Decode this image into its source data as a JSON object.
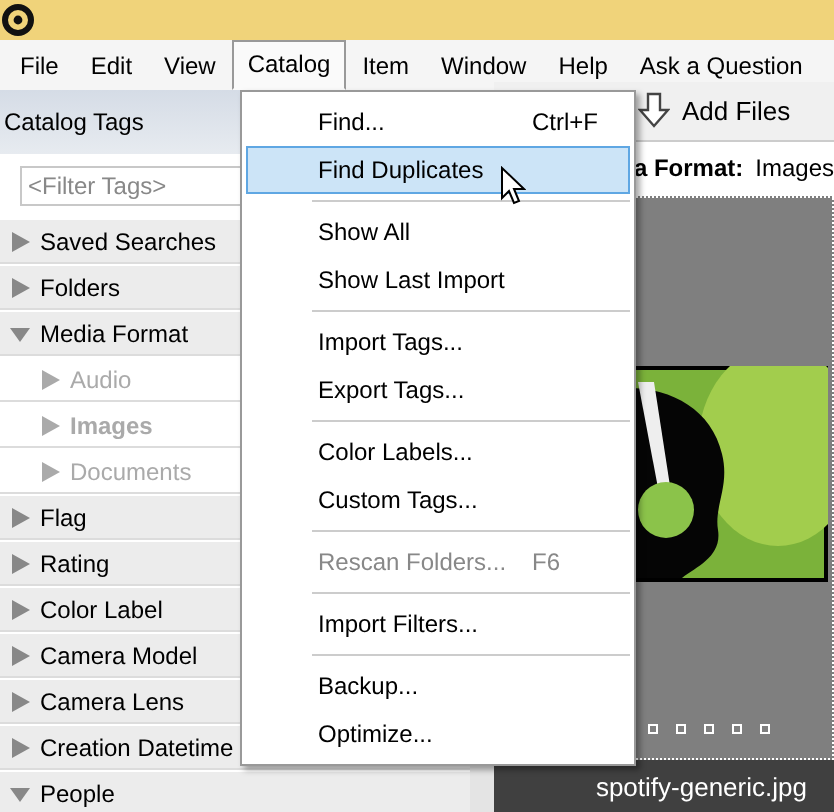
{
  "menu_bar": [
    {
      "label": "File",
      "selected": false
    },
    {
      "label": "Edit",
      "selected": false
    },
    {
      "label": "View",
      "selected": false
    },
    {
      "label": "Catalog",
      "selected": true
    },
    {
      "label": "Item",
      "selected": false
    },
    {
      "label": "Window",
      "selected": false
    },
    {
      "label": "Help",
      "selected": false
    },
    {
      "label": "Ask a Question",
      "selected": false
    }
  ],
  "sidebar": {
    "title": "Catalog Tags",
    "filter": {
      "placeholder": "<Filter Tags>"
    },
    "items": [
      {
        "label": "Saved Searches",
        "expanded": false
      },
      {
        "label": "Folders",
        "expanded": false
      },
      {
        "label": "Media Format",
        "expanded": true,
        "children": [
          {
            "label": "Audio",
            "selected": false
          },
          {
            "label": "Images",
            "selected": true
          },
          {
            "label": "Documents",
            "selected": false
          }
        ]
      },
      {
        "label": "Flag",
        "expanded": false
      },
      {
        "label": "Rating",
        "expanded": false
      },
      {
        "label": "Color Label",
        "expanded": false
      },
      {
        "label": "Camera Model",
        "expanded": false
      },
      {
        "label": "Camera Lens",
        "expanded": false
      },
      {
        "label": "Creation Datetime",
        "expanded": false
      },
      {
        "label": "People",
        "expanded": true
      }
    ]
  },
  "toolbar": {
    "add_files": "Add Files"
  },
  "breadcrumb": {
    "label": "a Format:",
    "value": "Images"
  },
  "thumbnail": {
    "kind": "picture",
    "caption": "spotify-generic.jpg"
  },
  "dropdown": [
    {
      "kind": "item",
      "label": "Find...",
      "shortcut": "Ctrl+F",
      "selected": false,
      "disabled": false
    },
    {
      "kind": "item",
      "label": "Find Duplicates",
      "selected": true,
      "disabled": false
    },
    {
      "kind": "separator"
    },
    {
      "kind": "item",
      "label": "Show All",
      "selected": false,
      "disabled": false
    },
    {
      "kind": "item",
      "label": "Show Last Import",
      "selected": false,
      "disabled": false
    },
    {
      "kind": "separator"
    },
    {
      "kind": "item",
      "label": "Import Tags...",
      "selected": false,
      "disabled": false
    },
    {
      "kind": "item",
      "label": "Export Tags...",
      "selected": false,
      "disabled": false
    },
    {
      "kind": "separator"
    },
    {
      "kind": "item",
      "label": "Color Labels...",
      "selected": false,
      "disabled": false
    },
    {
      "kind": "item",
      "label": "Custom Tags...",
      "selected": false,
      "disabled": false
    },
    {
      "kind": "separator"
    },
    {
      "kind": "item",
      "label": "Rescan Folders...",
      "shortcut": "F6",
      "selected": false,
      "disabled": true
    },
    {
      "kind": "separator"
    },
    {
      "kind": "item",
      "label": "Import Filters...",
      "selected": false,
      "disabled": false
    },
    {
      "kind": "separator"
    },
    {
      "kind": "item",
      "label": "Backup...",
      "selected": false,
      "disabled": false
    },
    {
      "kind": "item",
      "label": "Optimize...",
      "selected": false,
      "disabled": false
    }
  ]
}
